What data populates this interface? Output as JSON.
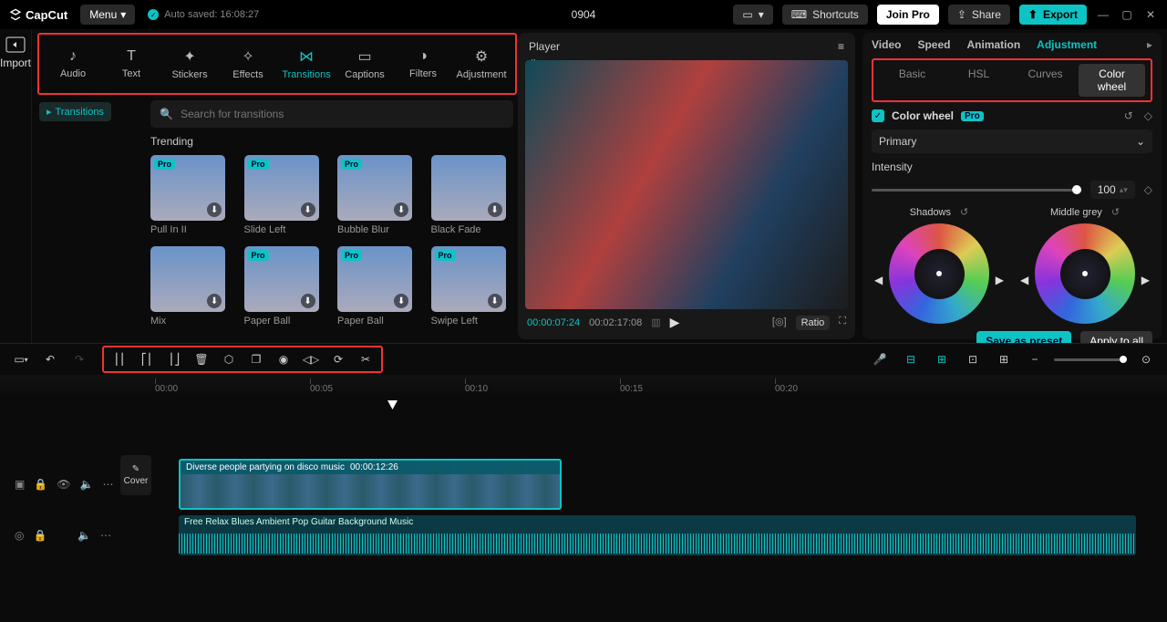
{
  "app": {
    "logo": "CapCut",
    "menu": "Menu",
    "autosaved": "Auto saved: 16:08:27",
    "project": "0904"
  },
  "topButtons": {
    "shortcuts": "Shortcuts",
    "joinPro": "Join Pro",
    "share": "Share",
    "export": "Export"
  },
  "importLabel": "Import",
  "libTabs": [
    "Audio",
    "Text",
    "Stickers",
    "Effects",
    "Transitions",
    "Captions",
    "Filters",
    "Adjustment"
  ],
  "libActiveIndex": 4,
  "transitionsPill": "Transitions",
  "searchPlaceholder": "Search for transitions",
  "sectionTitle": "Trending",
  "thumbs": [
    {
      "label": "Pull In II",
      "pro": true,
      "dl": true
    },
    {
      "label": "Slide Left",
      "pro": true,
      "dl": true
    },
    {
      "label": "Bubble Blur",
      "pro": true,
      "dl": true
    },
    {
      "label": "Black Fade",
      "pro": false,
      "dl": true
    },
    {
      "label": "Mix",
      "pro": false,
      "dl": true
    },
    {
      "label": "Paper Ball",
      "pro": true,
      "dl": true
    },
    {
      "label": "Paper Ball",
      "pro": true,
      "dl": true
    },
    {
      "label": "Swipe Left",
      "pro": true,
      "dl": true
    }
  ],
  "player": {
    "title": "Player",
    "current": "00:00:07:24",
    "duration": "00:02:17:08",
    "ratioBtn": "Ratio"
  },
  "adjust": {
    "tabs": [
      "Video",
      "Speed",
      "Animation",
      "Adjustment"
    ],
    "activeTab": 3,
    "subTabs": [
      "Basic",
      "HSL",
      "Curves",
      "Color wheel"
    ],
    "subActive": 3,
    "cwLabel": "Color wheel",
    "proBadge": "Pro",
    "dropdown": "Primary",
    "intensityLabel": "Intensity",
    "intensityValue": "100",
    "wheel1": "Shadows",
    "wheel2": "Middle grey",
    "savePreset": "Save as preset",
    "applyAll": "Apply to all"
  },
  "ruler": [
    "00:00",
    "00:05",
    "00:10",
    "00:15",
    "00:20"
  ],
  "rulerPos": [
    170,
    340,
    510,
    680,
    850
  ],
  "clipVideo": {
    "name": "Diverse people partying on disco music",
    "time": "00:00:12:26"
  },
  "clipAudio": {
    "name": "Free Relax Blues Ambient Pop Guitar Background Music"
  },
  "coverLabel": "Cover"
}
